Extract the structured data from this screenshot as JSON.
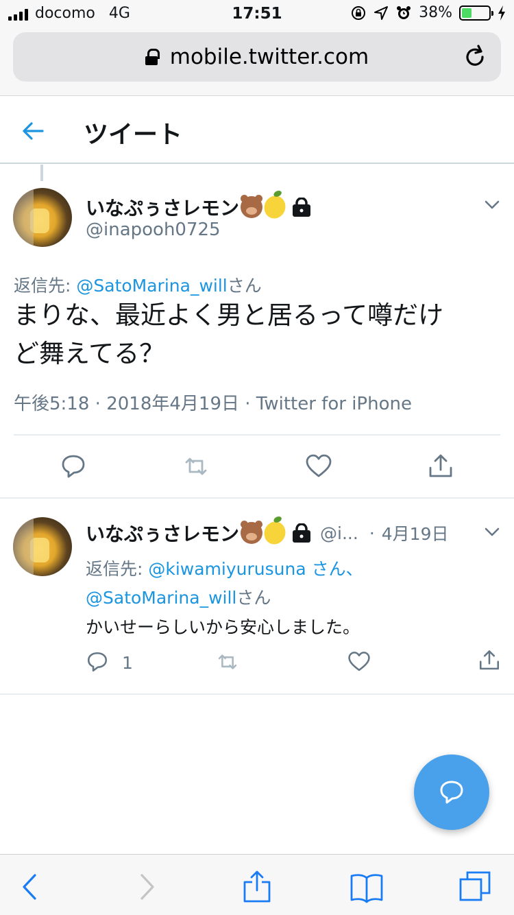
{
  "status_bar": {
    "carrier": "docomo",
    "network": "4G",
    "time": "17:51",
    "battery": "38%",
    "battery_level": 0.38
  },
  "browser": {
    "url": "mobile.twitter.com"
  },
  "header": {
    "title": "ツイート"
  },
  "main_tweet": {
    "display_name": "いなぷぅさレモン",
    "handle": "@inapooh0725",
    "reply_prefix": "返信先: ",
    "reply_to": "@SatoMarina_will",
    "reply_suffix": "さん",
    "text_line1": "まりな、最近よく男と居るって噂だけ",
    "text_line2": "ど舞えてる？",
    "time": "午後5:18",
    "date": "2018年4月19日",
    "source": "Twitter for iPhone"
  },
  "reply_tweet": {
    "display_name": "いなぷぅさレモン",
    "handle_truncated": "@i...",
    "date": "4月19日",
    "reply_prefix": "返信先: ",
    "reply_to_1": "@kiwamiyurusuna さん、",
    "reply_to_2": "@SatoMarina_will",
    "reply_suffix": "さん",
    "text": "かいせーらしいから安心しました。",
    "reply_count": "1"
  },
  "colors": {
    "accent": "#1b95e0",
    "icon_gray": "#657786",
    "fab": "#4aa1eb",
    "safari_blue": "#1a7cf4"
  }
}
